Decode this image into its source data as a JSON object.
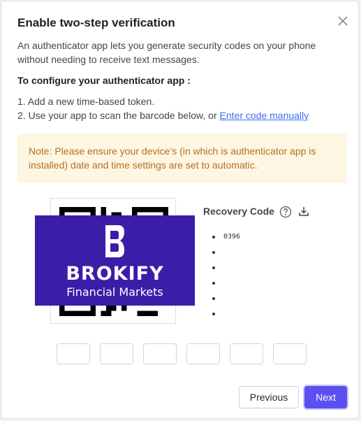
{
  "dialog": {
    "title": "Enable two-step verification",
    "description": "An authenticator app lets you generate security codes on your phone without needing to receive text messages.",
    "configure_heading": "To configure your authenticator app :",
    "step1": "1. Add a new time-based token.",
    "step2_prefix": "2. Use your app to scan the barcode below, or ",
    "step2_link": "Enter code manually",
    "note": "Note: Please ensure your device’s (in which is authenticator app is installed) date and time settings are set to automatic.",
    "close_icon": "close-icon"
  },
  "brand_overlay": {
    "name": "BROKIFY",
    "tagline": "Financial Markets",
    "color": "#3a1ea8"
  },
  "recovery": {
    "heading": "Recovery Code",
    "help_icon": "question-circle-icon",
    "download_icon": "download-icon",
    "codes": [
      "0396",
      "",
      "",
      "",
      "",
      ""
    ]
  },
  "otp": {
    "digits": [
      "",
      "",
      "",
      "",
      "",
      ""
    ]
  },
  "footer": {
    "previous_label": "Previous",
    "next_label": "Next",
    "accent_color": "#5b4ff2"
  }
}
